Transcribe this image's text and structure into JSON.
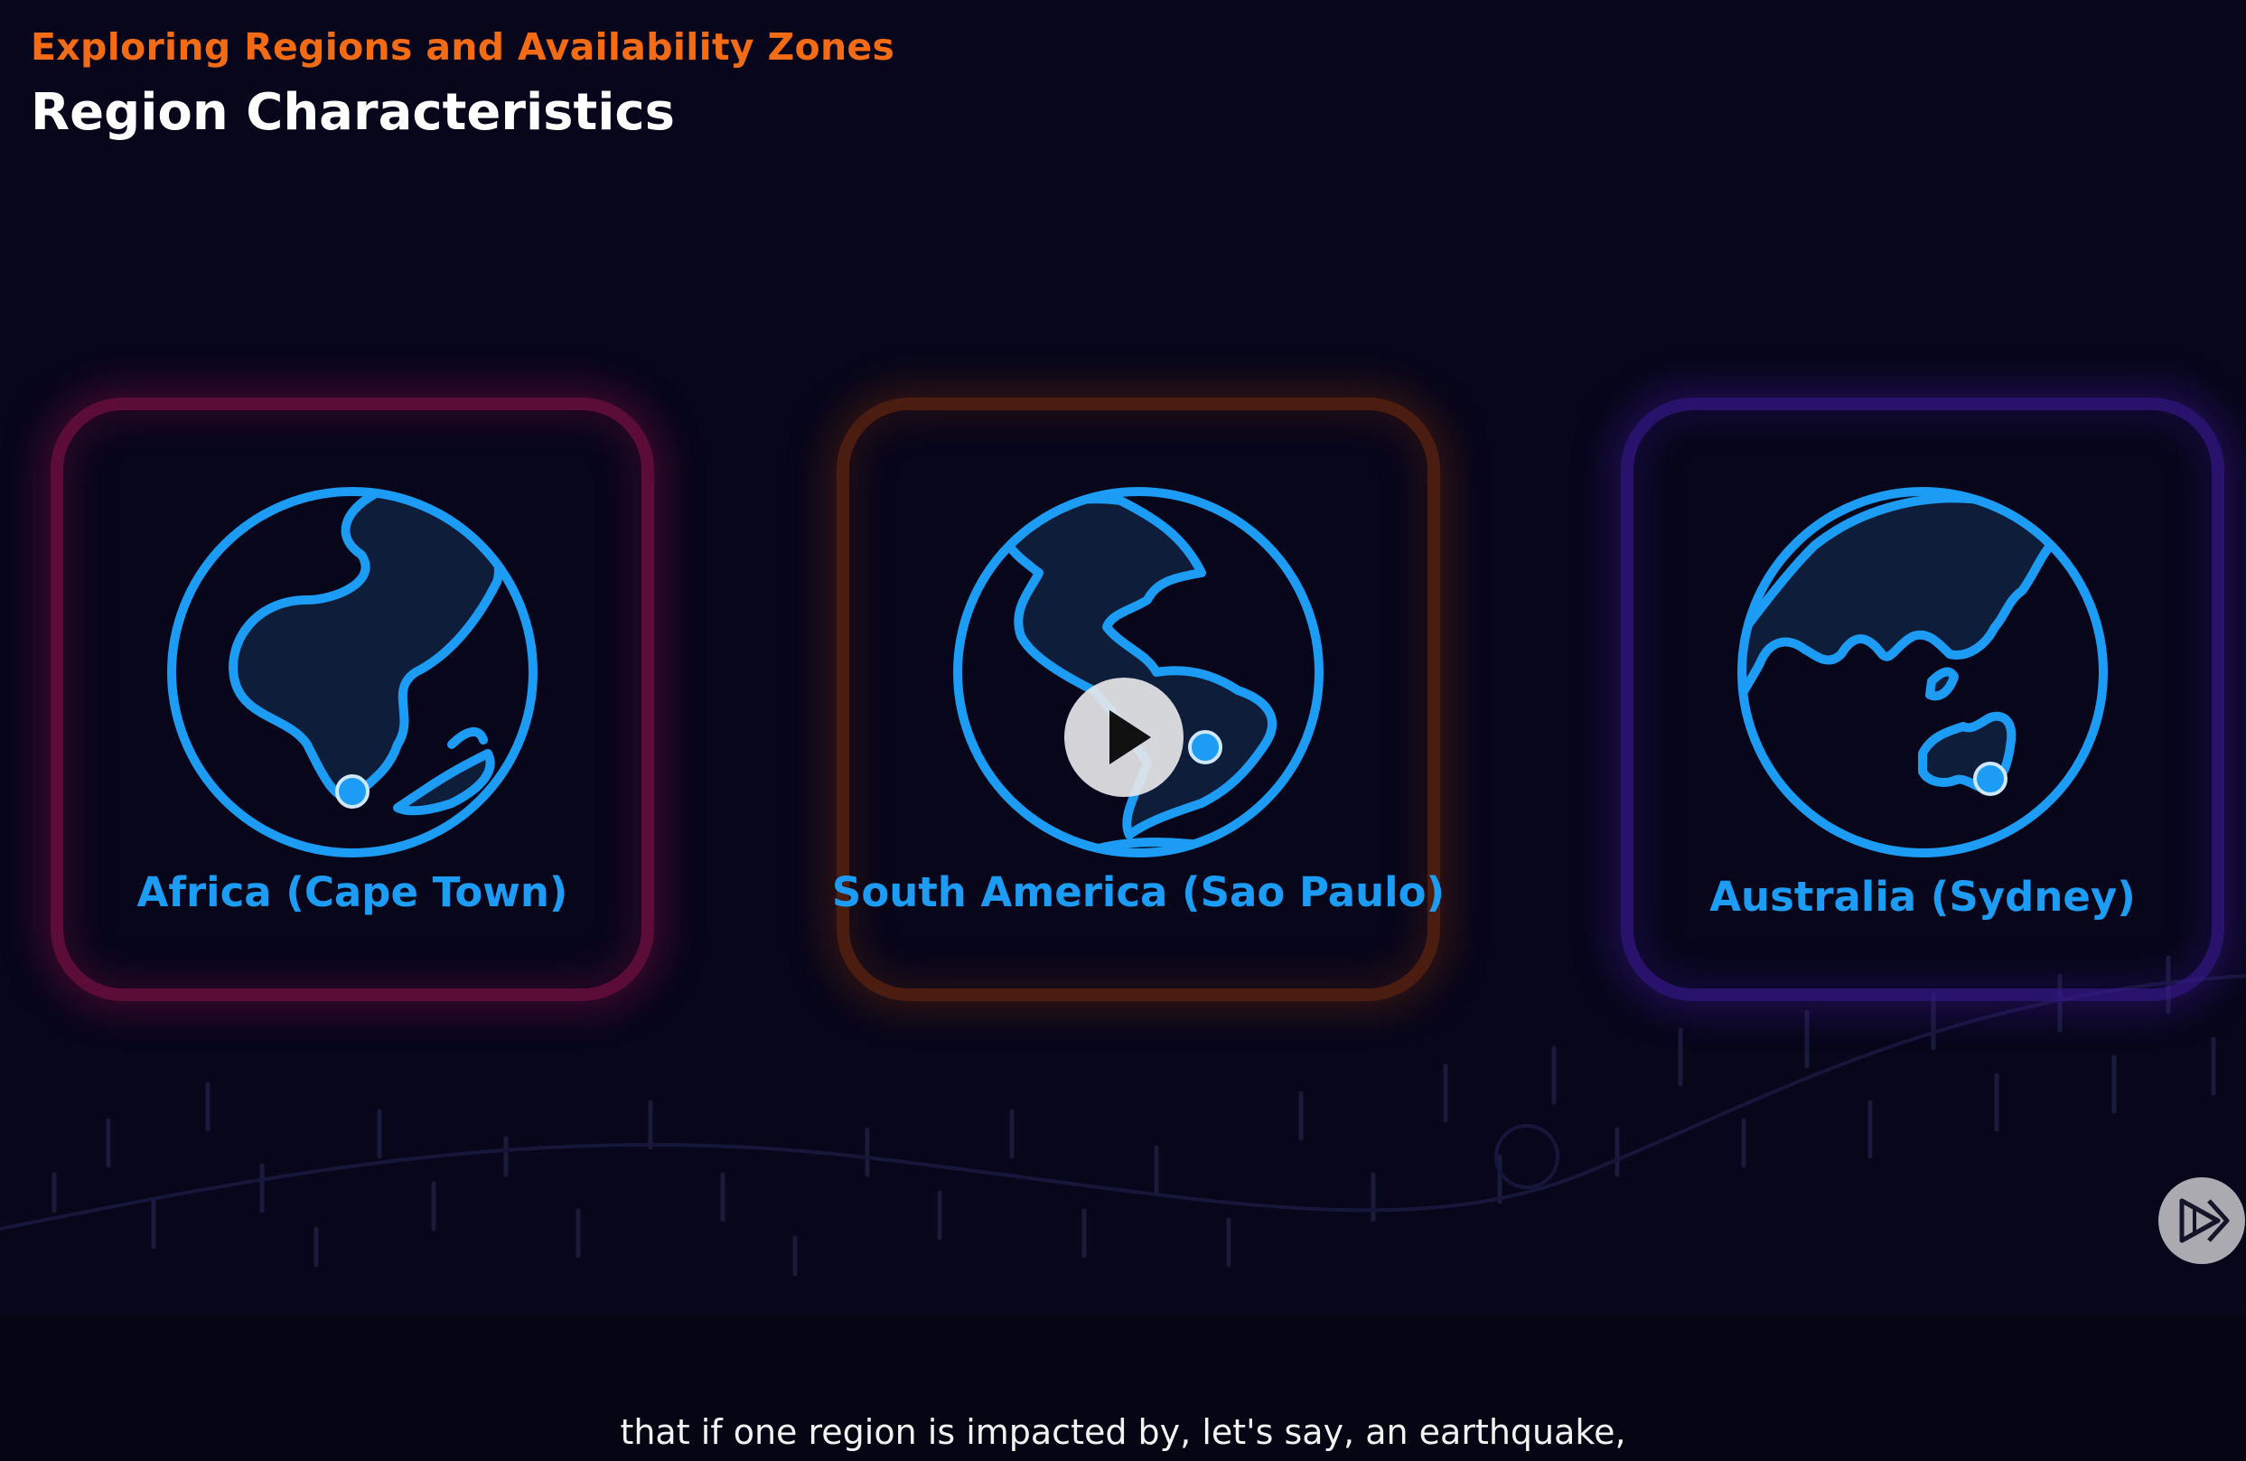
{
  "header": {
    "course_section": "Exploring Regions and Availability Zones",
    "title": "Region Characteristics"
  },
  "regions": [
    {
      "label": "Africa (Cape Town)",
      "accent": "#a3145a",
      "icon": "globe-africa-icon"
    },
    {
      "label": "South America (Sao Paulo)",
      "accent": "#7a2d0c",
      "icon": "globe-south-america-icon"
    },
    {
      "label": "Australia (Sydney)",
      "accent": "#3c1996",
      "icon": "globe-australia-icon"
    }
  ],
  "player": {
    "play_icon": "play-icon",
    "logo_icon": "pluralsight-logo-icon"
  },
  "caption": {
    "text": "that if one region is impacted by, let's say, an earthquake,"
  },
  "colors": {
    "background": "#07061a",
    "accent_orange": "#f46b15",
    "globe_blue": "#1c9cf4",
    "land_fill": "#0d1d3a"
  }
}
